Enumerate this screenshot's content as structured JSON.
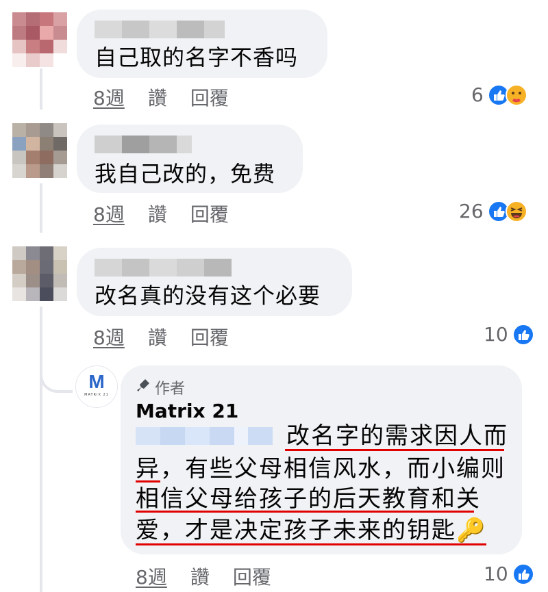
{
  "comments": [
    {
      "text": "自己取的名字不香吗",
      "time": "8週",
      "like": "讚",
      "reply": "回覆",
      "reaction_count": "6",
      "reactions": [
        "like-icon",
        "care-icon"
      ]
    },
    {
      "text": "我自己改的，免费",
      "time": "8週",
      "like": "讚",
      "reply": "回覆",
      "reaction_count": "26",
      "reactions": [
        "like-icon",
        "haha-icon"
      ]
    },
    {
      "text": "改名真的没有这个必要",
      "time": "8週",
      "like": "讚",
      "reply": "回覆",
      "reaction_count": "10",
      "reactions": [
        "like-icon"
      ]
    }
  ],
  "author_reply": {
    "badge": "作者",
    "name": "Matrix 21",
    "logo_letter": "M",
    "logo_sub": "MATRIX 21",
    "lines": [
      "改名字的需求因人而",
      "异，有些父母相信风水，而小编则",
      "相信父母给孩子的后天教育和关",
      "爱，才是决定孩子未来的钥匙"
    ],
    "emoji": "🔑",
    "time": "8週",
    "like": "讚",
    "reply": "回覆",
    "reaction_count": "10"
  },
  "colors": {
    "bubble": "#f0f2f5",
    "like_blue": "#1877f2",
    "underline": "#e00000",
    "meta": "#65676b"
  }
}
